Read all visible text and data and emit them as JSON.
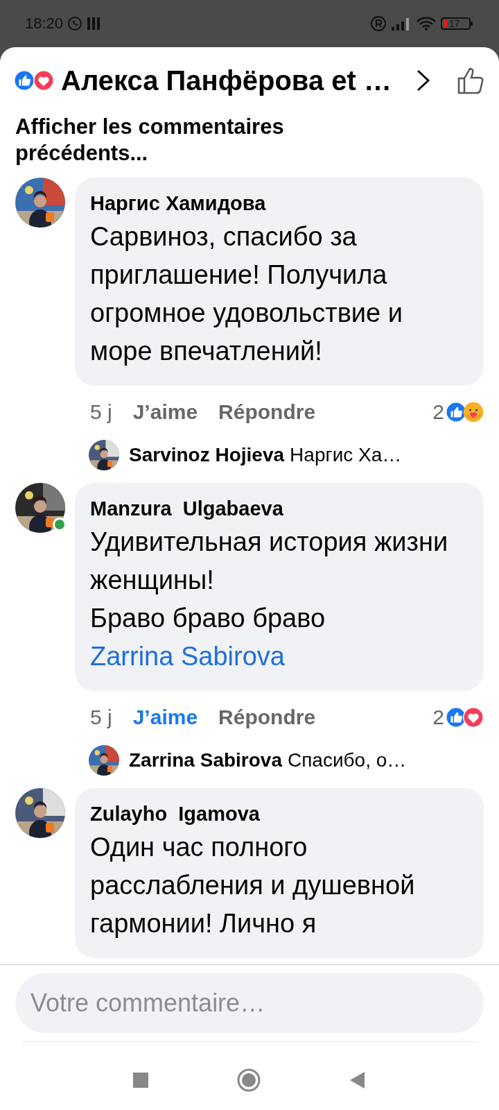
{
  "status_bar": {
    "time": "18:20",
    "battery": "17"
  },
  "header": {
    "reactions": [
      {
        "kind": "like"
      },
      {
        "kind": "love"
      }
    ],
    "title": "Алекса Панфёрова et …"
  },
  "previous_link": "Afficher les commentaires précédents...",
  "comments": [
    {
      "author": "Наргис Хамидова",
      "online": false,
      "text": "Сарвиноз, спасибо за приглашение! Получила огромное удовольствие и море впечатлений!",
      "time": "5 j",
      "like_label": "J’aime",
      "liked": false,
      "reply_label": "Répondre",
      "reaction_count": "2",
      "reactions": [
        {
          "kind": "like"
        },
        {
          "kind": "care"
        }
      ],
      "reply": {
        "author": "Sarvinoz Hojieva",
        "text": "Наргис Ха…"
      }
    },
    {
      "author": "Manzura  Ulgabaeva",
      "online": true,
      "text": "Удивительная история жизни женщины!\nБраво браво браво",
      "mention": "Zarrina Sabirova",
      "time": "5 j",
      "like_label": "J’aime",
      "liked": true,
      "reply_label": "Répondre",
      "reaction_count": "2",
      "reactions": [
        {
          "kind": "like"
        },
        {
          "kind": "love"
        }
      ],
      "reply": {
        "author": "Zarrina Sabirova",
        "text": "Спасибо, о…"
      }
    },
    {
      "author": "Zulayho  Igamova",
      "online": false,
      "text": "Один час полного расслабления и душевной гармонии! Лично я"
    }
  ],
  "composer": {
    "placeholder": "Votre commentaire…"
  }
}
